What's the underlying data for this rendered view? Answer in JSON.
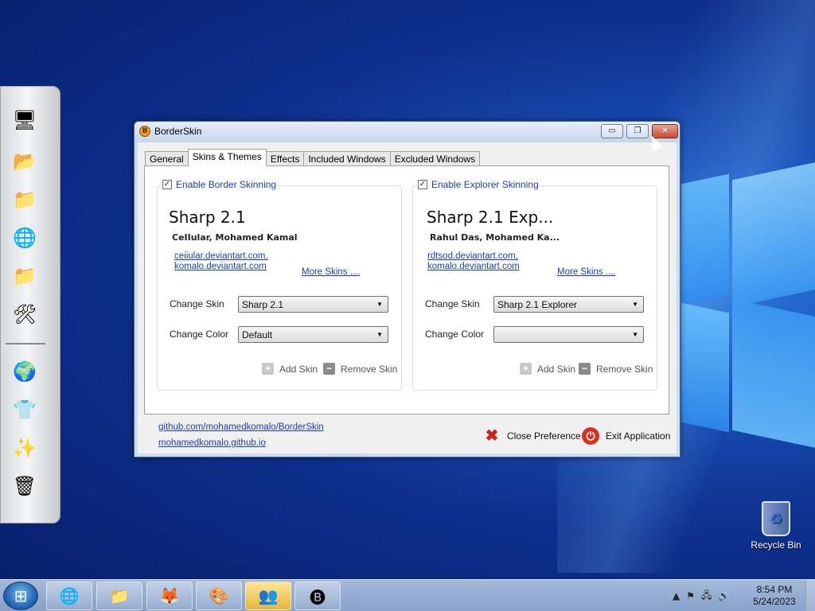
{
  "window": {
    "title": "BorderSkin",
    "controls": {
      "minimize": "▭",
      "maximize": "❐",
      "close": "✕"
    }
  },
  "tabs": [
    {
      "label": "General"
    },
    {
      "label": "Skins & Themes",
      "active": true
    },
    {
      "label": "Effects"
    },
    {
      "label": "Included Windows"
    },
    {
      "label": "Excluded Windows"
    }
  ],
  "border_group": {
    "enable_label": "Enable Border Skinning",
    "checked": true,
    "skin_name": "Sharp 2.1",
    "author": "CeIIular, Mohamed Kamal",
    "link1": "ceiiular.deviantart.com,",
    "link2": "komalo.deviantart.com",
    "more_skins": "More Skins ....",
    "change_skin_label": "Change Skin",
    "change_skin_value": "Sharp 2.1",
    "change_color_label": "Change Color",
    "change_color_value": "Default",
    "add_skin": "Add Skin",
    "remove_skin": "Remove Skin"
  },
  "explorer_group": {
    "enable_label": "Enable Explorer Skinning",
    "checked": true,
    "skin_name": "Sharp 2.1 Exp...",
    "author": "Rahul Das, Mohamed Ka...",
    "link1": "rdtsod.deviantart.com,",
    "link2": "komalo.deviantart.com",
    "more_skins": "More Skins ....",
    "change_skin_label": "Change Skin",
    "change_skin_value": "Sharp 2.1 Explorer",
    "change_color_label": "Change Color",
    "change_color_value": "",
    "add_skin": "Add Skin",
    "remove_skin": "Remove Skin"
  },
  "footer": {
    "github_link": "github.com/mohamedkomalo/BorderSkin",
    "site_link": "mohamedkomalo.github.io",
    "close_pref": "Close Preference",
    "exit_app": "Exit Application"
  },
  "desktop": {
    "recycle_bin": "Recycle Bin"
  },
  "taskbar": {
    "time": "8:54 PM",
    "date": "5/24/2023",
    "pinned": [
      "chrome-icon",
      "explorer-icon",
      "firefox-icon",
      "paint-icon",
      "messenger-icon",
      "borderskin-icon"
    ]
  },
  "colors": {
    "link": "#1a3faa",
    "close_button": "#c84a2e",
    "desktop": "#0d2f8c"
  }
}
